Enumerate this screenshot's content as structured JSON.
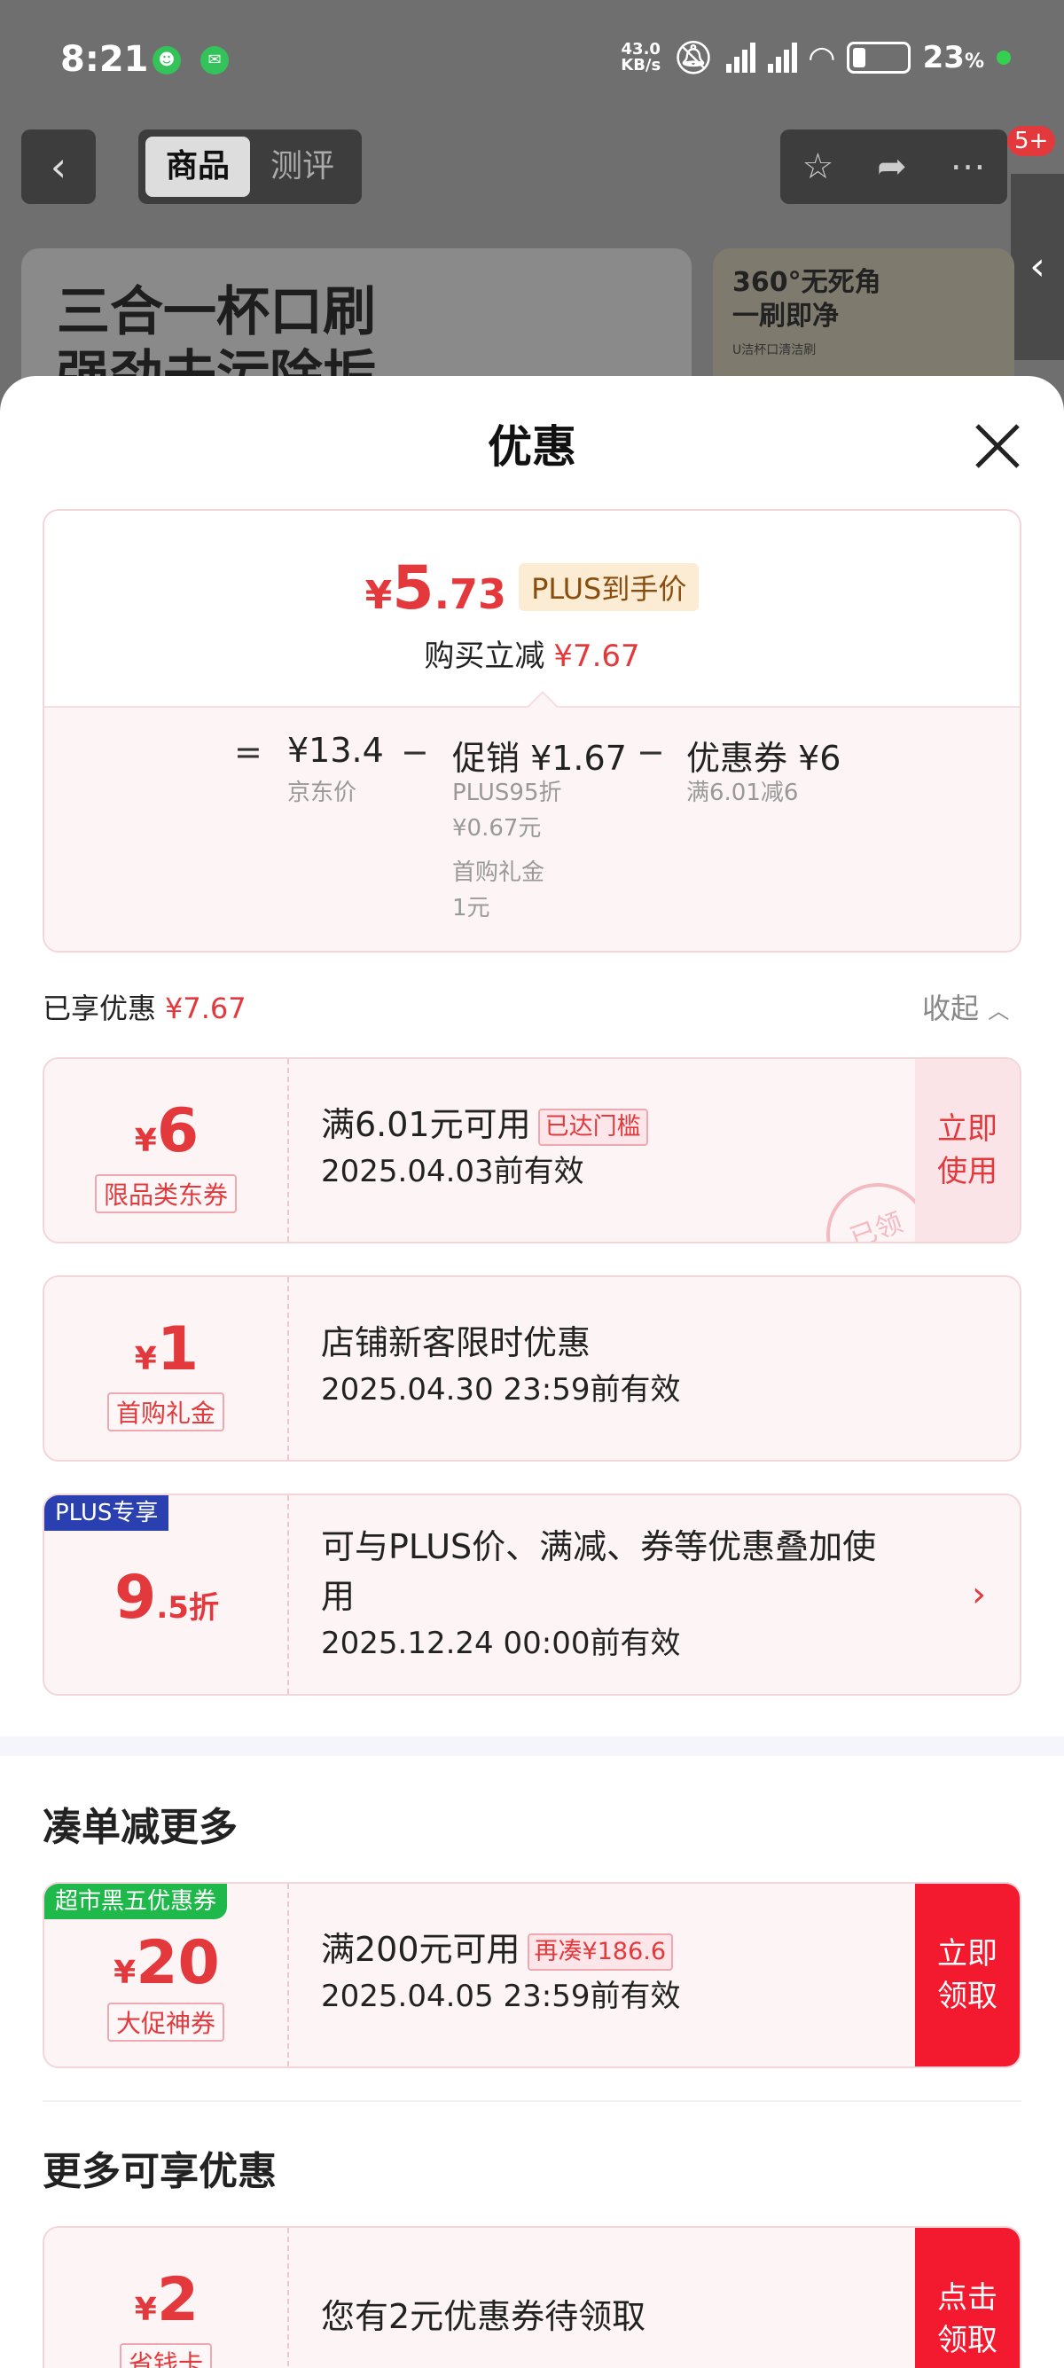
{
  "status_bar": {
    "time": "8:21",
    "net_speed_value": "43.0",
    "net_speed_unit": "KB/s",
    "battery": "23",
    "battery_unit": "%"
  },
  "top_nav": {
    "tabs": [
      "商品",
      "测评"
    ],
    "badge": "5+"
  },
  "banners": {
    "left_text": "三合一杯口刷\n强劲去污除垢",
    "right_line1": "360°无死角",
    "right_line2": "一刷即净",
    "right_sub": "U洁杯口清洁刷"
  },
  "sheet": {
    "title": "优惠",
    "summary": {
      "price_currency": "¥",
      "price_int": "5",
      "price_dec": ".73",
      "plus_tag": "PLUS到手价",
      "reduce_label": "购买立减",
      "reduce_value": "¥7.67",
      "eq_sign": "=",
      "minus_sign": "−",
      "jd_price": "¥13.4",
      "jd_label": "京东价",
      "promo": "促销 ¥1.67",
      "promo_detail_1": "PLUS95折",
      "promo_detail_2": "¥0.67元",
      "promo_detail_3": "首购礼金",
      "promo_detail_4": "1元",
      "coupon": "优惠券 ¥6",
      "coupon_detail": "满6.01减6"
    },
    "enjoyed": {
      "label": "已享优惠",
      "value": "¥7.67",
      "collapse": "收起"
    },
    "coupons": [
      {
        "currency": "¥",
        "amount": "6",
        "tag": "限品类东券",
        "line1": "满6.01元可用",
        "pill": "已达门槛",
        "line2": "2025.04.03前有效",
        "action": "立即\n使用",
        "stamp": "已领"
      },
      {
        "currency": "¥",
        "amount": "1",
        "tag": "首购礼金",
        "line1": "店铺新客限时优惠",
        "line2": "2025.04.30 23:59前有效"
      },
      {
        "corner": "PLUS专享",
        "amount": "9",
        "suffix": ".5折",
        "line1a": "可与PLUS价、满减、券等优惠叠加使",
        "line1b": "用",
        "line2": "2025.12.24 00:00前有效",
        "arrow": "›"
      }
    ],
    "section_more": {
      "title": "凑单减更多",
      "coupon": {
        "corner": "超市黑五优惠券",
        "currency": "¥",
        "amount": "20",
        "tag": "大促神券",
        "line1": "满200元可用",
        "pill": "再凑¥186.6",
        "line2": "2025.04.05 23:59前有效",
        "action": "立即\n领取"
      }
    },
    "section_extra": {
      "title": "更多可享优惠",
      "coupon": {
        "currency": "¥",
        "amount": "2",
        "tag": "省钱卡",
        "line1": "您有2元优惠券待领取",
        "action": "点击\n领取"
      }
    }
  },
  "colors": {
    "accent_red": "#e4393c",
    "action_red": "#f3192e",
    "plus_blue": "#2a3fb0",
    "promo_green": "#1fb84a"
  }
}
